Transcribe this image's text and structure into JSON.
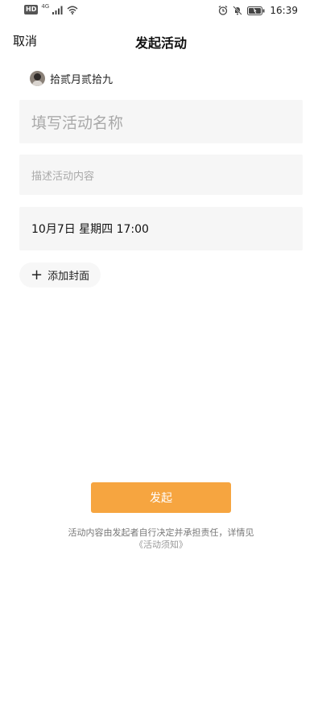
{
  "status_bar": {
    "hd": "HD",
    "network": "4G",
    "time": "16:39"
  },
  "nav": {
    "cancel_label": "取消",
    "title": "发起活动"
  },
  "user": {
    "name": "拾贰月贰拾九"
  },
  "form": {
    "name_placeholder": "填写活动名称",
    "description_placeholder": "描述活动内容",
    "datetime": "10月7日 星期四 17:00",
    "add_cover_label": "添加封面"
  },
  "submit": {
    "label": "发起",
    "color": "#f6a540"
  },
  "footer": {
    "disclaimer": "活动内容由发起者自行决定并承担责任，详情见",
    "notice_link": "《活动须知》"
  }
}
